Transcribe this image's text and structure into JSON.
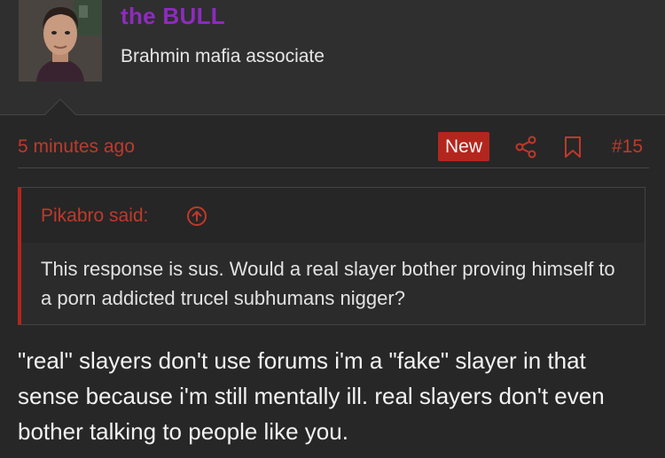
{
  "user": {
    "name": "the BULL",
    "title": "Brahmin mafia associate"
  },
  "post": {
    "time": "5 minutes ago",
    "badge": "New",
    "number": "#15",
    "quote": {
      "author_label": "Pikabro said:",
      "text": "This response is sus. Would a real slayer bother proving himself to a porn addicted trucel subhumans nigger?"
    },
    "body": "\"real\" slayers don't use forums i'm a \"fake\" slayer in that sense because i'm still mentally ill. real slayers don't even bother talking to people like you."
  },
  "icons": {
    "share": "share-icon",
    "bookmark": "bookmark-icon",
    "quote_jump": "arrow-up-circle-icon"
  },
  "colors": {
    "username": "#8e2bbf",
    "accent": "#c0392b",
    "badge_bg": "#b3261e",
    "background": "#272727"
  }
}
